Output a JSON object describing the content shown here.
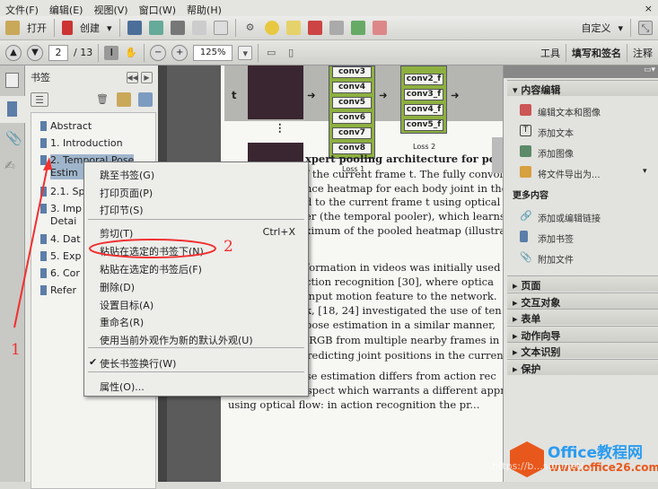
{
  "menubar": [
    "文件(F)",
    "编辑(E)",
    "视图(V)",
    "窗口(W)",
    "帮助(H)"
  ],
  "toolbar": {
    "open": "打开",
    "create": "创建",
    "customize": "自定义"
  },
  "nav": {
    "page": "2",
    "total": "/ 13",
    "zoom": "125%",
    "tabs": [
      "工具",
      "填写和签名",
      "注释"
    ]
  },
  "bookmarks": {
    "title": "书签",
    "items": [
      {
        "label": "Abstract"
      },
      {
        "label": "1. Introduction"
      },
      {
        "label": "2. Temporal Pose",
        "label2": "Estim",
        "selected": true
      },
      {
        "label": "2.1. Sp"
      },
      {
        "label": "3. Imp",
        "label2": "Detai"
      },
      {
        "label": "4. Dat"
      },
      {
        "label": "5. Exp"
      },
      {
        "label": "6. Cor"
      },
      {
        "label": "Refer"
      }
    ]
  },
  "context_menu": {
    "items": [
      {
        "label": "跳至书签(G)"
      },
      {
        "label": "打印页面(P)"
      },
      {
        "label": "打印节(S)"
      },
      {
        "label": "剪切(T)",
        "shortcut": "Ctrl+X"
      },
      {
        "label": "粘贴在选定的书签下(N)",
        "highlighted": true
      },
      {
        "label": "粘贴在选定的书签后(F)"
      },
      {
        "label": "删除(D)"
      },
      {
        "label": "设置目标(A)"
      },
      {
        "label": "重命名(R)"
      },
      {
        "label": "使用当前外观作为新的默认外观(U)"
      },
      {
        "label": "使长书签换行(W)",
        "checked": true
      },
      {
        "label": "属性(O)..."
      }
    ]
  },
  "annotations": {
    "step1": "1",
    "step2": "2",
    "color": "#f03030"
  },
  "figure": {
    "t": "t",
    "conv_a": [
      "conv3",
      "conv4",
      "conv5",
      "conv6",
      "conv7",
      "conv8"
    ],
    "conv_b": [
      "conv2_f",
      "conv3_f",
      "conv4_f",
      "conv5_f"
    ],
    "loss1": "Loss 1",
    "loss2": "Loss 2"
  },
  "doc_lines": [
    "xpert pooling architecture for pose es",
    "f the current frame t.  The fully convolu",
    "nce heatmap for each body joint in these f",
    "d to the current frame t using optical flov",
    "er (the temporal pooler), which learns hov",
    "ximum of the pooled heatmap (illustrated",
    "formation in videos was initially used",
    "ction recognition [30], where optica",
    "input motion feature to the network.",
    "k, [18, 24] investigated the use of ten",
    "pose estimation in a similar manner,",
    "putting flow or RGB from multiple nearby frames in",
    "network, and predicting joint positions in the current f",
    "However, pose estimation differs from action rec",
    "tion in a key respect which warrants a different appro",
    "using optical flow: in action recognition the pr..."
  ],
  "right_panel": {
    "section": "内容编辑",
    "items": [
      "编辑文本和图像",
      "添加文本",
      "添加图像",
      "将文件导出为..."
    ],
    "more": "更多内容",
    "more_items": [
      "添加或编辑链接",
      "添加书签",
      "附加文件"
    ],
    "sections": [
      "页面",
      "交互对象",
      "表单",
      "动作向导",
      "文本识别",
      "保护"
    ]
  },
  "watermark": {
    "brand": "Office教程网",
    "url": "www.office26.com",
    "csdn": "https://b...sdn.net/..."
  }
}
